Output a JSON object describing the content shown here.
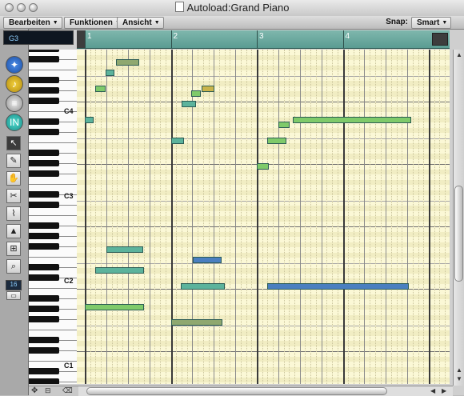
{
  "window": {
    "title": "Autoload:Grand Piano"
  },
  "toolbar": {
    "menus": [
      {
        "label": "Bearbeiten"
      },
      {
        "label": "Funktionen"
      },
      {
        "label": "Ansicht"
      }
    ],
    "snap_label": "Snap:",
    "snap_value": "Smart"
  },
  "position_display": "G3",
  "zoom_value": "16",
  "ruler": {
    "bars": [
      "1",
      "2",
      "3",
      "4"
    ]
  },
  "keyboard": {
    "octave_labels": [
      "C4",
      "C3",
      "C2",
      "C1"
    ]
  },
  "tools": [
    {
      "icon": "pointer-icon"
    },
    {
      "icon": "pencil-icon"
    },
    {
      "icon": "hand-icon"
    },
    {
      "icon": "scissors-icon"
    },
    {
      "icon": "glue-icon"
    },
    {
      "icon": "velocity-icon"
    },
    {
      "icon": "quantize-icon"
    },
    {
      "icon": "magnifier-icon"
    }
  ],
  "colors": {
    "grid_bg": "#fbf8d6",
    "note_green": "#7fca6a",
    "note_teal": "#5cb39c",
    "note_blue": "#4a7fc0",
    "ruler": "#6aa79d"
  },
  "notes": [
    {
      "bar": 1.36,
      "len": 0.27,
      "pitch": 79,
      "color": "#8fa870"
    },
    {
      "bar": 1.24,
      "len": 0.1,
      "pitch": 77,
      "color": "#5cb39c"
    },
    {
      "bar": 1.12,
      "len": 0.12,
      "pitch": 74,
      "color": "#7fca6a"
    },
    {
      "bar": 2.36,
      "len": 0.15,
      "pitch": 74,
      "color": "#c9b44c"
    },
    {
      "bar": 2.24,
      "len": 0.11,
      "pitch": 73,
      "color": "#7fca6a"
    },
    {
      "bar": 2.13,
      "len": 0.16,
      "pitch": 71,
      "color": "#5cb39c"
    },
    {
      "bar": 1.0,
      "len": 0.1,
      "pitch": 68,
      "color": "#5cb39c"
    },
    {
      "bar": 3.42,
      "len": 1.38,
      "pitch": 68,
      "color": "#7fca6a"
    },
    {
      "bar": 3.25,
      "len": 0.13,
      "pitch": 67,
      "color": "#7fca6a"
    },
    {
      "bar": 2.0,
      "len": 0.15,
      "pitch": 64,
      "color": "#5cb39c"
    },
    {
      "bar": 3.12,
      "len": 0.22,
      "pitch": 64,
      "color": "#7fca6a"
    },
    {
      "bar": 3.0,
      "len": 0.14,
      "pitch": 59,
      "color": "#7fca6a"
    },
    {
      "bar": 1.25,
      "len": 0.43,
      "pitch": 43,
      "color": "#5cb39c"
    },
    {
      "bar": 2.26,
      "len": 0.33,
      "pitch": 41,
      "color": "#4a7fc0"
    },
    {
      "bar": 1.12,
      "len": 0.57,
      "pitch": 39,
      "color": "#5cb39c"
    },
    {
      "bar": 2.12,
      "len": 0.51,
      "pitch": 36,
      "color": "#5cb39c"
    },
    {
      "bar": 3.12,
      "len": 1.65,
      "pitch": 36,
      "color": "#4a7fc0"
    },
    {
      "bar": 1.0,
      "len": 0.69,
      "pitch": 32,
      "color": "#7fca6a"
    },
    {
      "bar": 2.0,
      "len": 0.6,
      "pitch": 29,
      "color": "#8fa870"
    }
  ]
}
